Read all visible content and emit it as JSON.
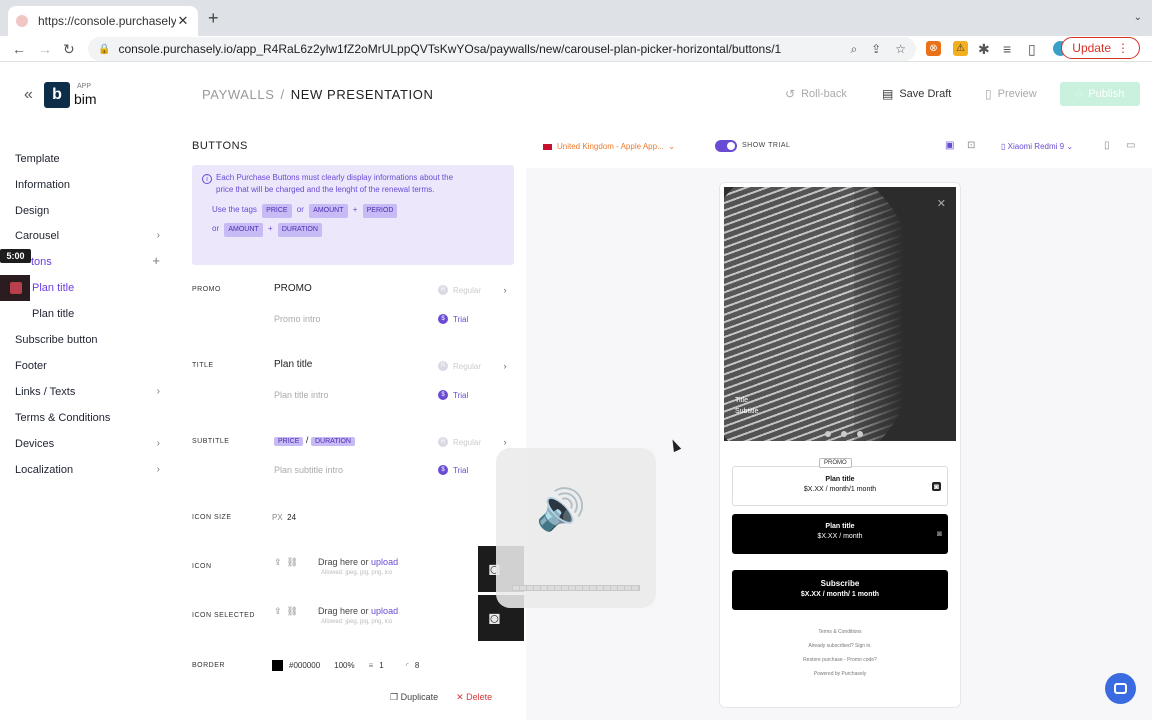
{
  "browser": {
    "tab_title": "https://console.purchasely.io/a",
    "url": "console.purchasely.io/app_R4RaL6z2ylw1fZ2oMrULppQVTsKwYOsa/paywalls/new/carousel-plan-picker-horizontal/buttons/1",
    "update_label": "Update"
  },
  "header": {
    "app_tag": "APP",
    "app_name": "bim",
    "logo_letter": "b",
    "breadcrumb_root": "PAYWALLS",
    "breadcrumb_sep": "/",
    "breadcrumb_current": "NEW PRESENTATION",
    "rollback": "Roll-back",
    "save_draft": "Save Draft",
    "preview": "Preview",
    "publish": "Publish"
  },
  "sidebar": {
    "template": "Template",
    "information": "Information",
    "design": "Design",
    "carousel": "Carousel",
    "buttons": "tons",
    "plan_title_active": "Plan title",
    "plan_title": "Plan title",
    "subscribe_button": "Subscribe button",
    "footer": "Footer",
    "links_texts": "Links / Texts",
    "terms": "Terms & Conditions",
    "devices": "Devices",
    "localization": "Localization",
    "timer": "5:00"
  },
  "editor": {
    "section": "BUTTONS",
    "note_line1": "Each Purchase Buttons must clearly display informations about the",
    "note_line2": "price that will be charged and the lenght of the renewal terms.",
    "use_tags": "Use the tags",
    "tag_price": "PRICE",
    "or": "or",
    "tag_amount": "AMOUNT",
    "plus": "+",
    "tag_period": "PERIOD",
    "tag_duration": "DURATION",
    "promo_label": "PROMO",
    "promo_value": "PROMO",
    "promo_intro": "Promo intro",
    "title_label": "TITLE",
    "title_value": "Plan title",
    "title_intro": "Plan title intro",
    "subtitle_label": "SUBTITLE",
    "subtitle_sep": "/",
    "subtitle_intro": "Plan subtitle intro",
    "regular": "Regular",
    "trial": "Trial",
    "icon_size_label": "ICON SIZE",
    "icon_size_unit": "PX",
    "icon_size_value": "24",
    "icon_label": "ICON",
    "icon_selected_label": "ICON SELECTED",
    "drag_here": "Drag here or",
    "upload": "upload",
    "allowed": "Allowed: jpeg, jpg, png, ico",
    "border_label": "BORDER",
    "border_color": "#000000",
    "border_opacity": "100%",
    "border_width": "1",
    "border_radius": "8",
    "duplicate": "Duplicate",
    "delete": "Delete"
  },
  "preview": {
    "country": "United Kingdom - Apple App...",
    "show_trial": "SHOW TRIAL",
    "device": "Xiaomi Redmi 9",
    "hero_title": "Title",
    "hero_subtitle": "Subtitle",
    "promo_tag": "PROMO",
    "plan1_name": "Plan title",
    "plan1_price": "$X.XX / month/1 month",
    "plan2_name": "Plan title",
    "plan2_price": "$X.XX / month",
    "subscribe": "Subscribe",
    "subscribe_price": "$X.XX / month/ 1 month",
    "terms": "Terms & Conditions",
    "already": "Already subscribed? Sign in.",
    "restore": "Restore purchase - Promo code?",
    "powered": "Powered by Purchasely"
  },
  "colors": {
    "accent": "#6a4bd4",
    "orange": "#f07b2e",
    "danger": "#d33a3a",
    "publish_disabled": "#c9f1de"
  }
}
